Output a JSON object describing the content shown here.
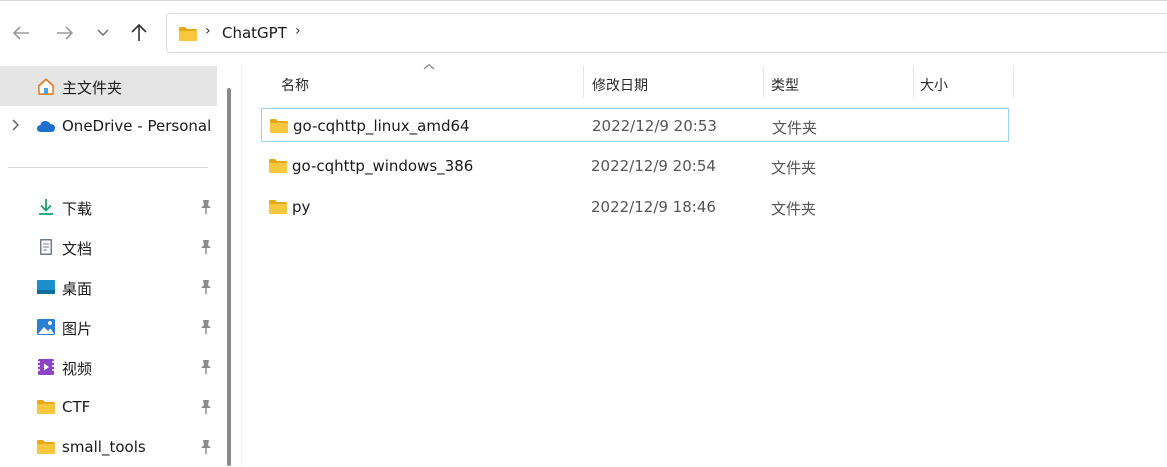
{
  "address_bar": {
    "crumb": "ChatGPT",
    "separator": "›"
  },
  "nav_buttons": {
    "back_icon": "arrow-left-icon",
    "forward_icon": "arrow-right-icon",
    "recent_icon": "chevron-down-icon",
    "up_icon": "arrow-up-icon"
  },
  "sidebar": {
    "home": {
      "label": "主文件夹"
    },
    "onedrive": {
      "label": "OneDrive - Personal"
    },
    "quick_access": [
      {
        "label": "下载",
        "icon": "download-icon",
        "pinned": true
      },
      {
        "label": "文档",
        "icon": "document-icon",
        "pinned": true
      },
      {
        "label": "桌面",
        "icon": "desktop-icon",
        "pinned": true
      },
      {
        "label": "图片",
        "icon": "pictures-icon",
        "pinned": true
      },
      {
        "label": "视频",
        "icon": "videos-icon",
        "pinned": true
      },
      {
        "label": "CTF",
        "icon": "folder-icon",
        "pinned": true
      },
      {
        "label": "small_tools",
        "icon": "folder-icon",
        "pinned": true
      }
    ]
  },
  "columns": {
    "name": "名称",
    "modified": "修改日期",
    "type": "类型",
    "size": "大小"
  },
  "files": [
    {
      "name": "go-cqhttp_linux_amd64",
      "modified": "2022/12/9 20:53",
      "type": "文件夹",
      "selected": true
    },
    {
      "name": "go-cqhttp_windows_386",
      "modified": "2022/12/9 20:54",
      "type": "文件夹",
      "selected": false
    },
    {
      "name": "py",
      "modified": "2022/12/9 18:46",
      "type": "文件夹",
      "selected": false
    }
  ],
  "colors": {
    "folder_yellow": "#f8c740",
    "folder_dark": "#e6a817",
    "selection_border": "#99d1f0",
    "sidebar_selected": "#e5e5e5",
    "onedrive_blue": "#1f6fd1"
  }
}
